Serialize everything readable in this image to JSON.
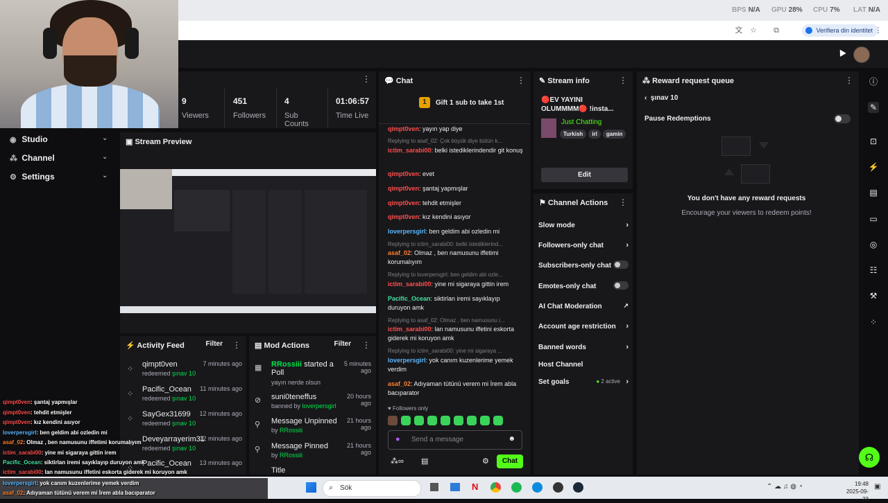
{
  "browser": {
    "stats": [
      {
        "label": "BPS",
        "value": "N/A"
      },
      {
        "label": "GPU",
        "value": "28%"
      },
      {
        "label": "CPU",
        "value": "7%"
      },
      {
        "label": "LAT",
        "value": "N/A"
      }
    ],
    "verify_label": "Verifiera din identitet"
  },
  "nav": {
    "items": [
      {
        "label": "Studio"
      },
      {
        "label": "Channel"
      },
      {
        "label": "Settings"
      }
    ]
  },
  "stats": [
    {
      "value": "9",
      "label": "Viewers"
    },
    {
      "value": "451",
      "label": "Followers"
    },
    {
      "value": "4",
      "label": "Sub Counts"
    },
    {
      "value": "01:06:57",
      "label": "Time Live"
    }
  ],
  "preview": {
    "title": "Stream Preview"
  },
  "activity": {
    "title": "Activity Feed",
    "filter": "Filter",
    "items": [
      {
        "name": "qimpt0ven",
        "action": "redeemed",
        "reward": "şınav 10",
        "time": "7 minutes ago"
      },
      {
        "name": "Pacific_Ocean",
        "action": "redeemed",
        "reward": "şınav 10",
        "time": "11 minutes ago"
      },
      {
        "name": "SayGex31699",
        "action": "redeemed",
        "reward": "şınav 10",
        "time": "12 minutes ago"
      },
      {
        "name": "Deveyarrayerim31",
        "action": "redeemed",
        "reward": "şınav 10",
        "time": "12 minutes ago"
      },
      {
        "name": "Pacific_Ocean",
        "action": "",
        "reward": "",
        "time": "13 minutes ago"
      }
    ]
  },
  "mods": {
    "title": "Mod Actions",
    "filter": "Filter",
    "items": [
      {
        "user": "RRossiii",
        "text": "started a Poll",
        "sub_prefix": "",
        "sub": "yayın nerde olsun",
        "time": "5 minutes ago"
      },
      {
        "user": "",
        "text": "suni0teneffus",
        "sub_prefix": "banned by",
        "sub": "loverpersgirl",
        "time": "20 hours ago"
      },
      {
        "user": "",
        "text": "Message Unpinned",
        "sub_prefix": "by",
        "sub": "RRossiii",
        "time": "21 hours ago"
      },
      {
        "user": "",
        "text": "Message Pinned",
        "sub_prefix": "by",
        "sub": "RRossiii",
        "time": "21 hours ago"
      },
      {
        "user": "",
        "text": "Title",
        "sub_prefix": "",
        "sub": "",
        "time": ""
      }
    ]
  },
  "chat": {
    "title": "Chat",
    "gift_count": "1",
    "gift_text": "Gift 1 sub to take 1st",
    "messages": [
      {
        "reply": "",
        "user": "qimpt0ven",
        "color": "#ff4e4e",
        "text": ": yayın yap diye"
      },
      {
        "reply": "Replying to asaf_02: Çok büyük diye bütün k...",
        "user": "ictim_sarabi00",
        "color": "#ff4e4e",
        "text": ": belki istediklerindendir git konuş"
      },
      {
        "reply": "",
        "user": "qimpt0ven",
        "color": "#ff4e4e",
        "text": ": evet"
      },
      {
        "reply": "",
        "user": "qimpt0ven",
        "color": "#ff4e4e",
        "text": ": şantaj yapmışlar"
      },
      {
        "reply": "",
        "user": "qimpt0ven",
        "color": "#ff4e4e",
        "text": ": tehdit etmişler"
      },
      {
        "reply": "",
        "user": "qimpt0ven",
        "color": "#ff4e4e",
        "text": ": kız kendini asıyor"
      },
      {
        "reply": "",
        "user": "loverpersgirl",
        "color": "#5ab7ff",
        "text": ": ben geldim abi ozledin mi"
      },
      {
        "reply": "Replying to ictim_sarabi00: belki istediklerind...",
        "user": "asaf_02",
        "color": "#ff7f2a",
        "text": ": Olmaz , ben namusunu iffetimi korumalıyım"
      },
      {
        "reply": "Replying to loverpersgirl: ben geldim abi ozle...",
        "user": "ictim_sarabi00",
        "color": "#ff4e4e",
        "text": ": yine mi sigaraya gittin irem"
      },
      {
        "reply": "",
        "user": "Pacific_Ocean",
        "color": "#46e0a0",
        "text": ": siktirlan iremi sayıklayıp duruyon amk"
      },
      {
        "reply": "Replying to asaf_02: Olmaz , ben namusunu i...",
        "user": "ictim_sarabi00",
        "color": "#ff4e4e",
        "text": ": lan namusunu iffetini eskorta giderek mi koruyon amk"
      },
      {
        "reply": "Replying to ictim_sarabi00: yine mi sigaraya ...",
        "user": "loverpersgirl",
        "color": "#5ab7ff",
        "text": ": yok canım kuzenlerime yemek verdim"
      },
      {
        "reply": "",
        "user": "asaf_02",
        "color": "#ff7f2a",
        "text": ": Adıyaman tütünü verem mi İrem abla bacıparator"
      }
    ],
    "followers_only": "Followers only",
    "placeholder": "Send a message",
    "send_label": "Chat"
  },
  "stream_info": {
    "title": "Stream info",
    "stream_title": "🔴EV YAYINI OLUMMMM🔴 !insta...",
    "category": "Just Chatting",
    "tags": [
      "Turkish",
      "irl",
      "gamin"
    ],
    "edit_label": "Edit"
  },
  "actions": {
    "title": "Channel Actions",
    "items": [
      {
        "label": "Slow mode",
        "type": "chevron"
      },
      {
        "label": "Followers-only chat",
        "type": "chevron"
      },
      {
        "label": "Subscribers-only chat",
        "type": "toggle"
      },
      {
        "label": "Emotes-only chat",
        "type": "toggle"
      },
      {
        "label": "AI Chat Moderation",
        "type": "external"
      },
      {
        "label": "Account age restriction",
        "type": "chevron"
      },
      {
        "label": "Banned words",
        "type": "chevron"
      },
      {
        "label": "Host Channel",
        "type": "none"
      },
      {
        "label": "Set goals",
        "type": "chevron",
        "badge": "2 active"
      }
    ]
  },
  "reward": {
    "title": "Reward request queue",
    "back_label": "şınav 10",
    "pause_label": "Pause Redemptions",
    "empty_title": "You don't have any reward requests",
    "empty_sub": "Encourage your viewers to redeem points!"
  },
  "overlay_chat": [
    {
      "user": "qimpt0ven",
      "color": "#ff4e4e",
      "text": ": şantaj yapmışlar"
    },
    {
      "user": "qimpt0ven",
      "color": "#ff4e4e",
      "text": ": tehdit etmişler"
    },
    {
      "user": "qimpt0ven",
      "color": "#ff4e4e",
      "text": ": kız kendini asıyor"
    },
    {
      "user": "loverpersgirl",
      "color": "#5ab7ff",
      "text": ": ben geldim abi ozledin mi"
    },
    {
      "user": "asaf_02",
      "color": "#ff7f2a",
      "text": ": Olmaz , ben namusunu iffetimi korumalıyım"
    },
    {
      "user": "ictim_sarabi00",
      "color": "#ff4e4e",
      "text": ": yine mi sigaraya gittin irem"
    },
    {
      "user": "Pacific_Ocean",
      "color": "#46e0a0",
      "text": ": siktirlan iremi sayıklayıp duruyon amk"
    },
    {
      "user": "ictim_sarabi00",
      "color": "#ff4e4e",
      "text": ": lan namusunu iffetini eskorta giderek mi koruyon amk"
    },
    {
      "user": "loverpersgirl",
      "color": "#5ab7ff",
      "text": ": yok canım kuzenlerime yemek verdim"
    },
    {
      "user": "asaf_02",
      "color": "#ff7f2a",
      "text": ": Adıyaman tütünü verem mi İrem abla bacıparator"
    }
  ],
  "taskbar": {
    "search_label": "Sök",
    "time": "19:48",
    "date": "2025-09-23"
  }
}
